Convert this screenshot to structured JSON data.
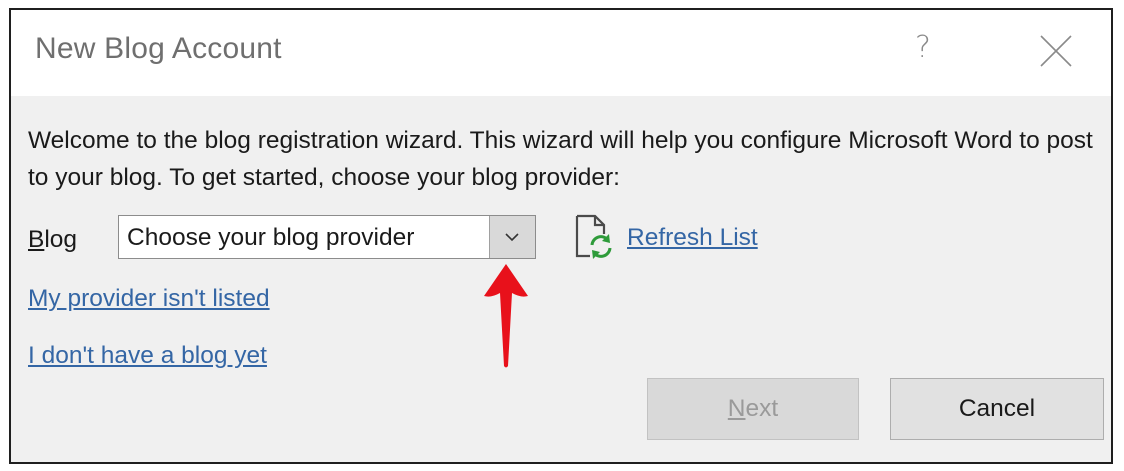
{
  "dialog": {
    "title": "New Blog Account",
    "help_glyph": "?",
    "close_icon": "close-icon"
  },
  "welcome_text": "Welcome to the blog registration wizard. This wizard will help you configure Microsoft Word to post to your blog. To get started, choose your blog provider:",
  "blog_field": {
    "label_accesskey": "B",
    "label_rest": "log",
    "selected_value": "Choose your blog provider",
    "dropdown_icon": "chevron-down-icon"
  },
  "refresh": {
    "icon": "document-refresh-icon",
    "label": "Refresh List"
  },
  "links": {
    "not_listed": "My provider isn't listed",
    "no_blog": "I don't have a blog yet"
  },
  "annotation": {
    "icon": "red-arrow-icon",
    "color": "#e8111b"
  },
  "buttons": {
    "next_accesskey": "N",
    "next_rest": "ext",
    "next_enabled": false,
    "cancel": "Cancel"
  },
  "colors": {
    "link": "#3466a5",
    "dialog_bg": "#f0f0f0",
    "titlebar_bg": "#ffffff",
    "title_text": "#6f6f6f"
  }
}
